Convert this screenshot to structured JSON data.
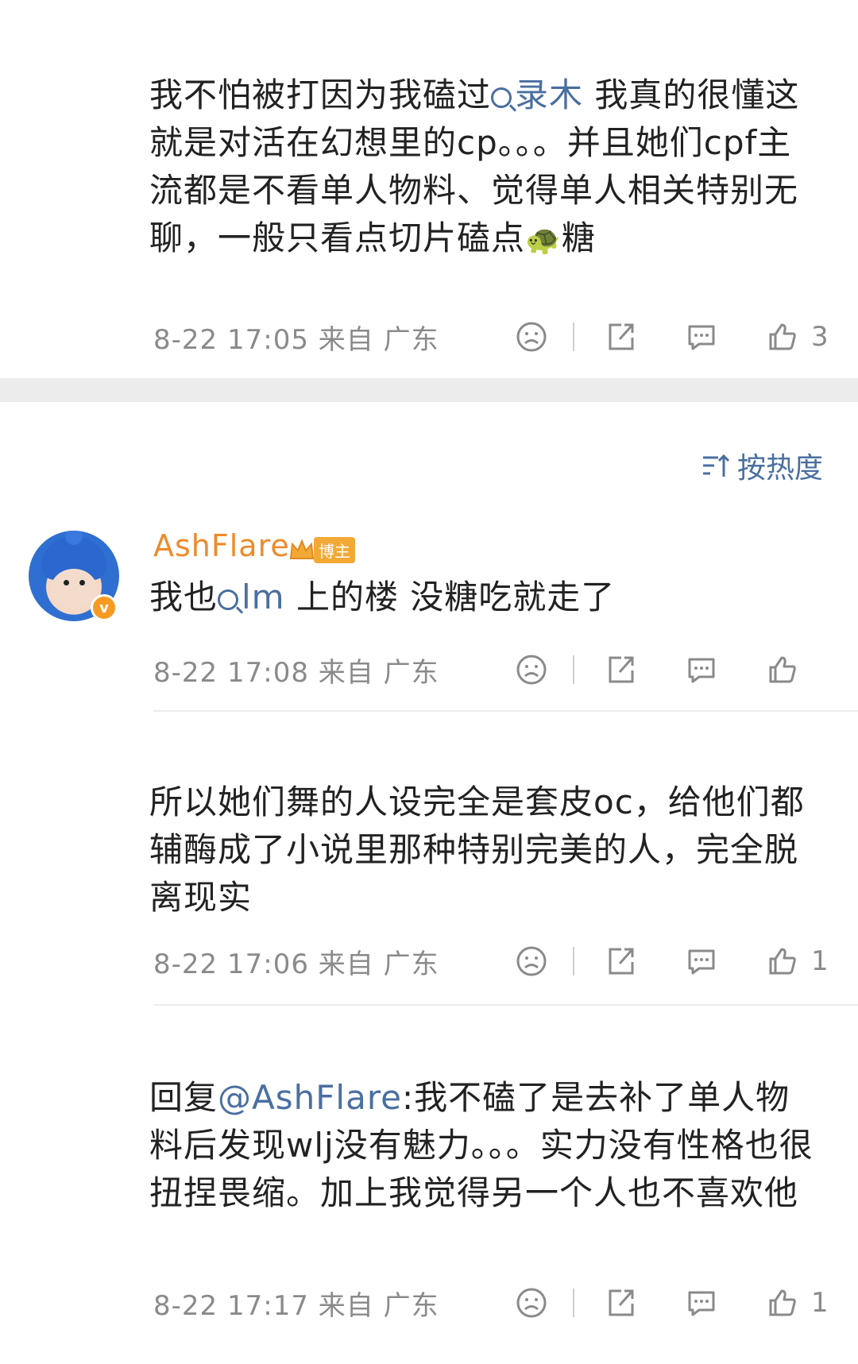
{
  "comment1": {
    "pre": "我不怕被打因为我磕过",
    "topic": "录木",
    "post": " 我真的很懂这就是对活在幻想里的cp。。。并且她们cpf主流都是不看单人物料、觉得单人相关特别无聊，一般只看点切片磕点",
    "emoji": "🐢",
    "end": "糖",
    "meta": "8-22 17:05 来自 广东",
    "likes": "3"
  },
  "sort": {
    "label": "按热度"
  },
  "reply_main": {
    "username": "AshFlare",
    "badge": "博主",
    "pre": "我也",
    "topic": "lm",
    "post": " 上的楼 没糖吃就走了",
    "meta": "8-22 17:08 来自 广东",
    "likes": ""
  },
  "reply2": {
    "text": "所以她们舞的人设完全是套皮oc，给他们都辅酶成了小说里那种特别完美的人，完全脱离现实",
    "meta": "8-22 17:06 来自 广东",
    "likes": "1"
  },
  "reply3": {
    "prefix": "回复",
    "mention": "@AshFlare",
    "text": ":我不磕了是去补了单人物料后发现wlj没有魅力。。。实力没有性格也很扭捏畏缩。加上我觉得另一个人也不喜欢他",
    "meta": "8-22 17:17 来自 广东",
    "likes": "1"
  },
  "icons": [
    "dislike-icon",
    "share-icon",
    "comment-icon",
    "like-icon",
    "sort-icon",
    "verified-icon",
    "crown-icon"
  ],
  "colors": {
    "link": "#4a6fa0",
    "username": "#ee8a2b",
    "meta": "#8a8a8a",
    "divider": "#ececec"
  }
}
